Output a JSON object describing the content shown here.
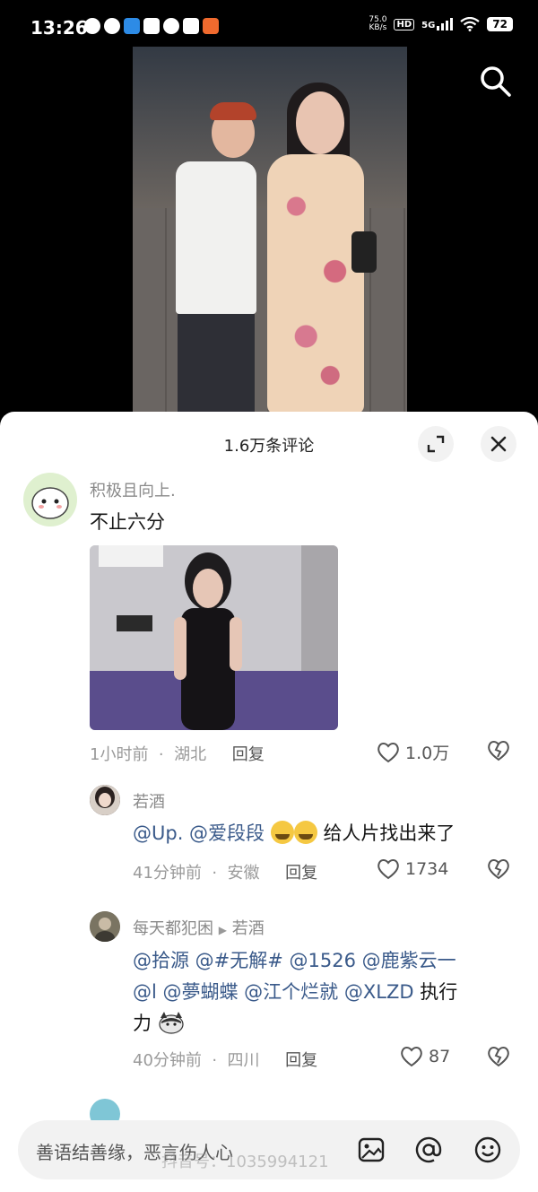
{
  "status_bar": {
    "time": "13:26",
    "net_speed": "75.0",
    "net_unit": "KB/s",
    "hd": "HD",
    "signal": "5G",
    "battery": "72"
  },
  "video": {
    "search_icon": "search-icon"
  },
  "comments_panel": {
    "title": "1.6万条评论",
    "expand_icon": "expand-icon",
    "close_icon": "close-icon",
    "comments": [
      {
        "user": "积极且向上.",
        "text": "不止六分",
        "time": "1小时前",
        "location": "湖北",
        "reply_label": "回复",
        "likes": "1.0万"
      }
    ],
    "replies": [
      {
        "user": "若酒",
        "mentions": "@Up. @爱段段",
        "text_after": "给人片找出来了",
        "time": "41分钟前",
        "location": "安徽",
        "reply_label": "回复",
        "likes": "1734"
      },
      {
        "user": "每天都犯困",
        "reply_to": "若酒",
        "line1": "@拾源 @#无解# @1526 @鹿紫云一",
        "line2_mentions": "@l @夢蝴蝶 @江个烂就 @XLZD",
        "line2_after": " 执行",
        "line3": "力",
        "time": "40分钟前",
        "location": "四川",
        "reply_label": "回复",
        "likes": "87"
      }
    ],
    "sep": "·"
  },
  "input": {
    "placeholder": "善语结善缘，恶言伤人心",
    "watermark": "抖音号：1035994121"
  }
}
